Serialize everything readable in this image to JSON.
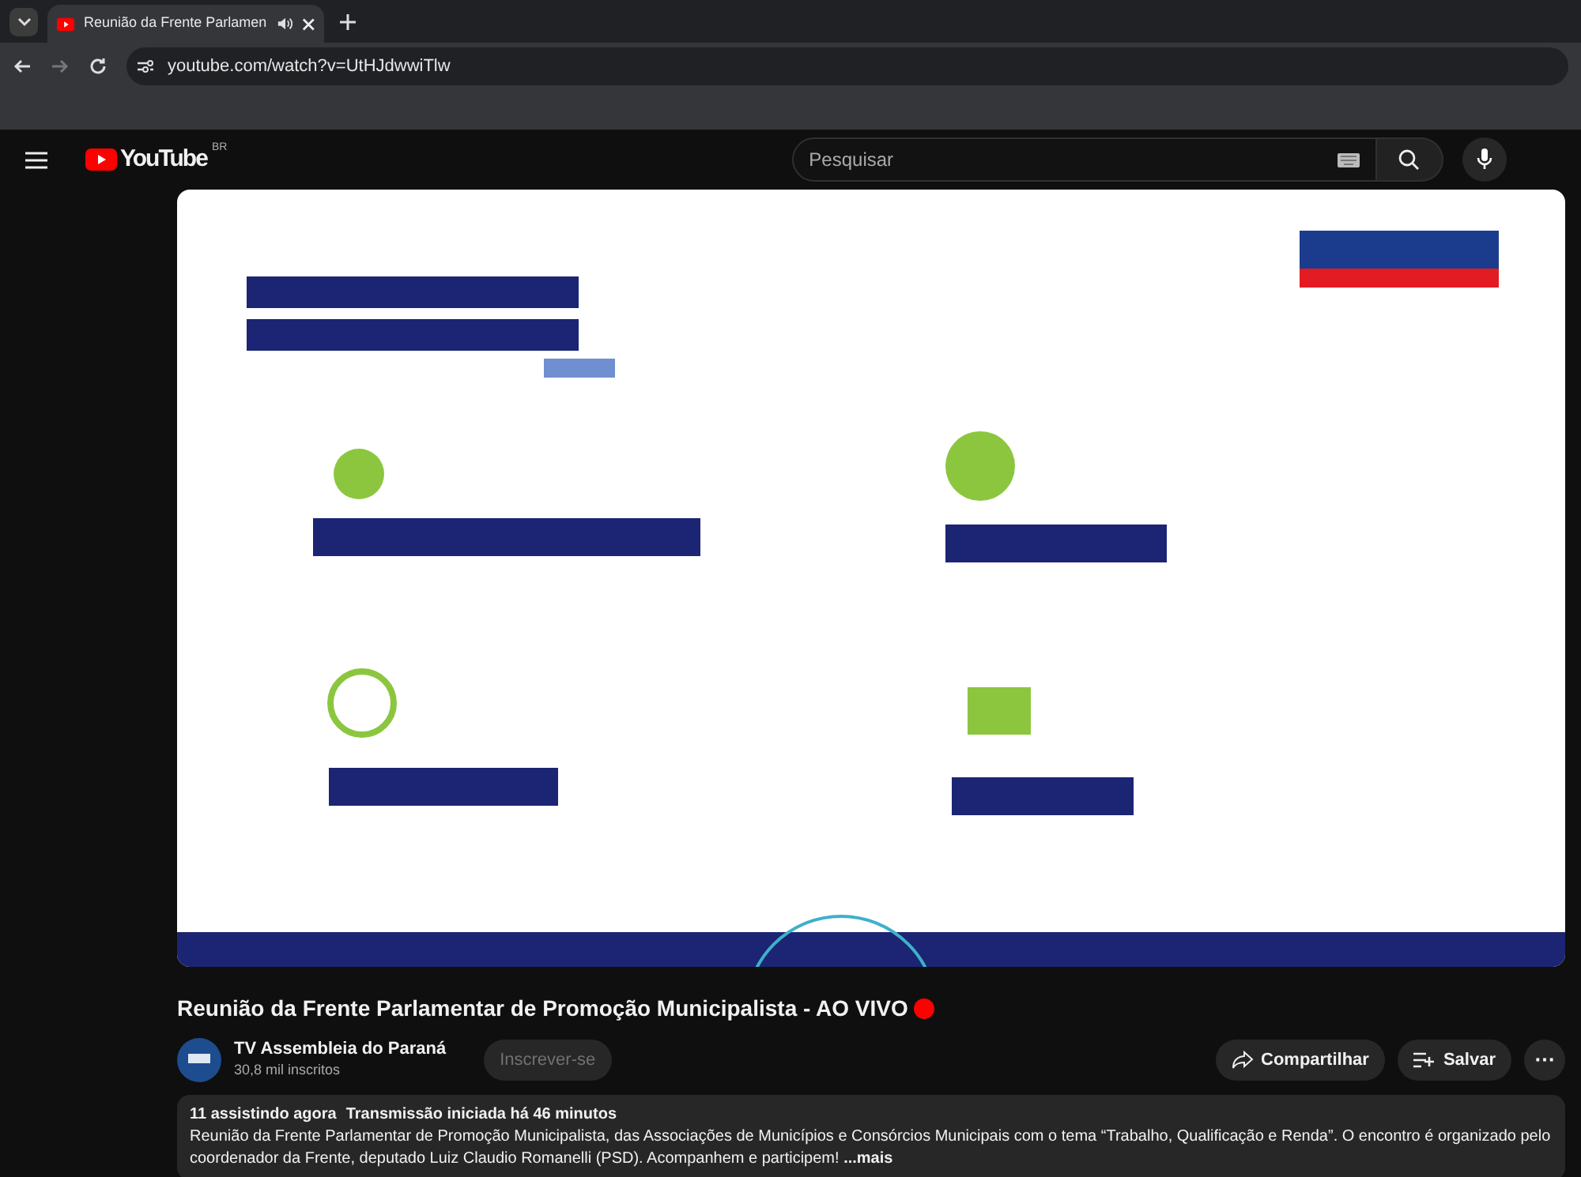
{
  "browser": {
    "tab": {
      "title": "Reunião da Frente Parlamen",
      "audible": true,
      "selected": true
    },
    "address": "youtube.com/watch?v=UtHJdwwiTlw"
  },
  "header": {
    "logo_text": "YouTube",
    "region": "BR",
    "search": {
      "placeholder": "Pesquisar"
    }
  },
  "video": {
    "kind": "picture",
    "live": true,
    "title": "Reunião da Frente Parlamentar de Promoção Municipalista - AO VIVO"
  },
  "channel": {
    "name": "TV Assembleia do Paraná",
    "subscribers": "30,8 mil inscritos",
    "subscribe_label": "Inscrever-se",
    "subscribed_disabled": true
  },
  "actions": [
    {
      "kind": "share",
      "label": "Compartilhar"
    },
    {
      "kind": "save",
      "label": "Salvar"
    },
    {
      "kind": "more",
      "label": "⋯"
    }
  ],
  "description": {
    "viewers": "11 assistindo agora",
    "started": "Transmissão iniciada há 46 minutos",
    "text": "Reunião da Frente Parlamentar de Promoção Municipalista, das Associações de Municípios e Consórcios Municipais com o tema “Trabalho, Qualificação e Renda”. O encontro é organizado pelo coordenador da Frente, deputado Luiz Claudio Romanelli (PSD). Acompanhem e participem!",
    "more": "...mais"
  }
}
